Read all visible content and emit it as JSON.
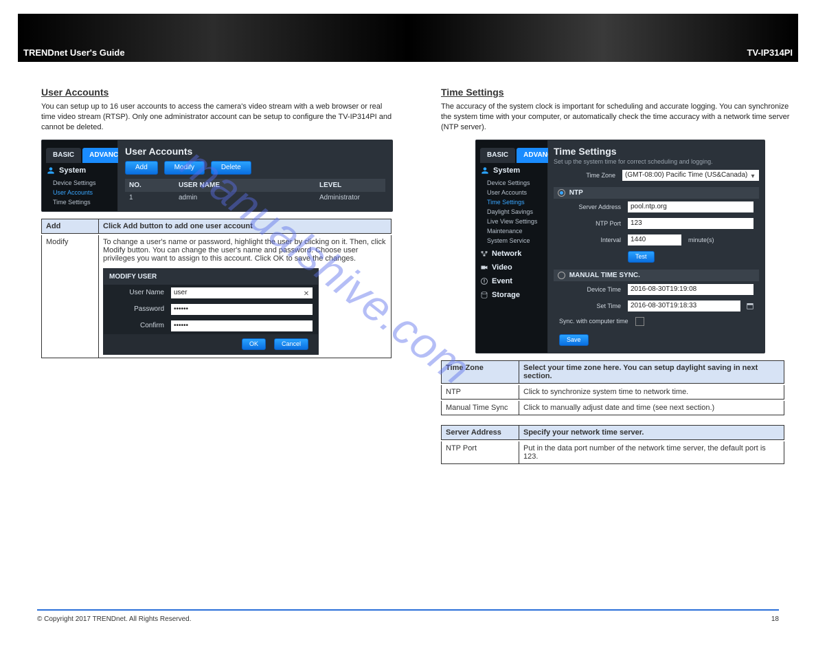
{
  "header": {
    "title": "TRENDnet User's Guide",
    "model": "TV-IP314PI"
  },
  "left": {
    "section_title": "User Accounts",
    "section_desc": "You can setup up to 16 user accounts to access the camera's video stream with a web browser or real time video stream (RTSP). Only one administrator account can be setup to configure the TV-IP314PI and cannot be deleted.",
    "tabs": {
      "basic": "BASIC",
      "advanced": "ADVANCED"
    },
    "panel_title": "User Accounts",
    "buttons": {
      "add": "Add",
      "modify": "Modify",
      "delete": "Delete"
    },
    "sidebar": {
      "system": "System",
      "items": [
        "Device Settings",
        "User Accounts",
        "Time Settings"
      ],
      "selected": "User Accounts"
    },
    "table": {
      "headers": [
        "NO.",
        "USER NAME",
        "LEVEL"
      ],
      "rows": [
        [
          "1",
          "admin",
          "Administrator"
        ]
      ]
    },
    "doc_table": {
      "head1": "Add",
      "head2": "Click Add button to add one user account",
      "row1": "Modify",
      "row2": "To change a user's name or password, highlight the user by clicking on it. Then, click Modify button. You can change the user's name and password. Choose user privileges you want to assign to this account. Click OK to save the changes."
    },
    "modify": {
      "title": "MODIFY USER",
      "u_label": "User Name",
      "u_value": "user",
      "p_label": "Password",
      "p_value": "••••••",
      "c_label": "Confirm",
      "c_value": "••••••",
      "ok": "OK",
      "cancel": "Cancel"
    }
  },
  "right": {
    "section_title": "Time Settings",
    "section_desc": "The accuracy of the system clock is important for scheduling and accurate logging. You can synchronize the system time with your computer, or automatically check the time accuracy with a network time server (NTP server).",
    "tabs": {
      "basic": "BASIC",
      "advanced": "ADVANCED"
    },
    "panel_title": "Time Settings",
    "panel_sub": "Set up the system time for correct scheduling and logging.",
    "sidebar": {
      "system": "System",
      "items": [
        "Device Settings",
        "User Accounts",
        "Time Settings",
        "Daylight Savings",
        "Live View Settings",
        "Maintenance",
        "System Service"
      ],
      "selected": "Time Settings",
      "network": "Network",
      "video": "Video",
      "event": "Event",
      "storage": "Storage"
    },
    "fields": {
      "tz_label": "Time Zone",
      "tz_value": "(GMT-08:00) Pacific Time (US&Canada)",
      "ntp_header": "NTP",
      "srv_label": "Server Address",
      "srv_value": "pool.ntp.org",
      "port_label": "NTP Port",
      "port_value": "123",
      "int_label": "Interval",
      "int_value": "1440",
      "int_unit": "minute(s)",
      "test": "Test",
      "manual_header": "MANUAL TIME SYNC.",
      "devtime_label": "Device Time",
      "devtime_value": "2016-08-30T19:19:08",
      "settime_label": "Set Time",
      "settime_value": "2016-08-30T19:18:33",
      "sync_label": "Sync. with computer time",
      "save": "Save"
    },
    "tbl1": {
      "h1": "Time Zone",
      "h2": "Select your time zone here. You can setup daylight saving in next section.",
      "ntp_label": "NTP",
      "ntp_desc": "Click to synchronize system time to network time.",
      "man_label": "Manual Time Sync",
      "man_desc": "Click to manually adjust date and time (see next section.)"
    },
    "tbl2": {
      "h1": "Server Address",
      "h2": "Specify your network time server.",
      "port_label": "NTP Port",
      "port_desc": "Put in the data port number of the network time server, the default port is 123."
    }
  },
  "footer": {
    "left": "© Copyright 2017 TRENDnet. All Rights Reserved.",
    "right": "18"
  },
  "watermark": "manualshive.com"
}
